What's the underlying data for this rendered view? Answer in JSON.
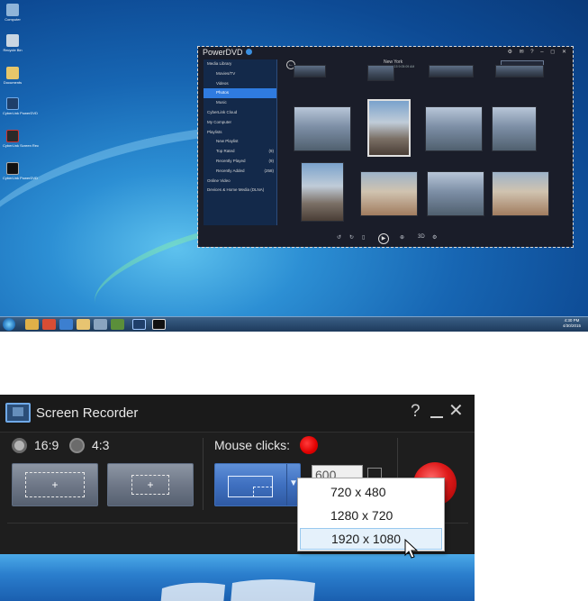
{
  "desktop": {
    "icons": [
      "Computer",
      "Recycle Bin",
      "Documents",
      "CyberLink PowerDVD",
      "CyberLink Screen Rec",
      "CyberLink PowerDVD"
    ],
    "clock": {
      "time": "4:30 PM",
      "date": "4/30/2015"
    }
  },
  "powerdvd": {
    "title": "PowerDVD",
    "window_controls": "⚙ ✉ ? – ◻ ✕",
    "location": "New York",
    "location_date": "4/30/2015 9:05:09 AM",
    "sidebar": [
      {
        "label": "Media Library",
        "level": 0,
        "count": ""
      },
      {
        "label": "Movies/TV",
        "level": 1,
        "count": ""
      },
      {
        "label": "Videos",
        "level": 1,
        "count": ""
      },
      {
        "label": "Photos",
        "level": 1,
        "count": "",
        "selected": true
      },
      {
        "label": "Music",
        "level": 1,
        "count": ""
      },
      {
        "label": "CyberLink Cloud",
        "level": 0,
        "count": ""
      },
      {
        "label": "My Computer",
        "level": 0,
        "count": ""
      },
      {
        "label": "Playlists",
        "level": 0,
        "count": ""
      },
      {
        "label": "New Playlist",
        "level": 1,
        "count": ""
      },
      {
        "label": "Top Rated",
        "level": 1,
        "count": "(9)"
      },
      {
        "label": "Recently Played",
        "level": 1,
        "count": "(9)"
      },
      {
        "label": "Recently Added",
        "level": 1,
        "count": "(258)"
      },
      {
        "label": "Online Video",
        "level": 0,
        "count": ""
      },
      {
        "label": "Devices & Home Media (DLNA)",
        "level": 0,
        "count": ""
      }
    ],
    "bottom_controls": {
      "threed": "3D"
    }
  },
  "recorder": {
    "title": "Screen Recorder",
    "help": "?",
    "close": "✕",
    "aspect_ratio": {
      "option_a": "16:9",
      "option_b": "4:3",
      "selected": "16:9"
    },
    "mouse_clicks_label": "Mouse clicks:",
    "width_value": "600",
    "resolution_options": [
      "720 x 480",
      "1280 x 720",
      "1920 x 1080"
    ],
    "hovered_option": "1920 x 1080",
    "colors": {
      "accent_blue": "#3f70c0",
      "record_red": "#e01b1b",
      "mouse_click_red": "#e00000"
    }
  }
}
